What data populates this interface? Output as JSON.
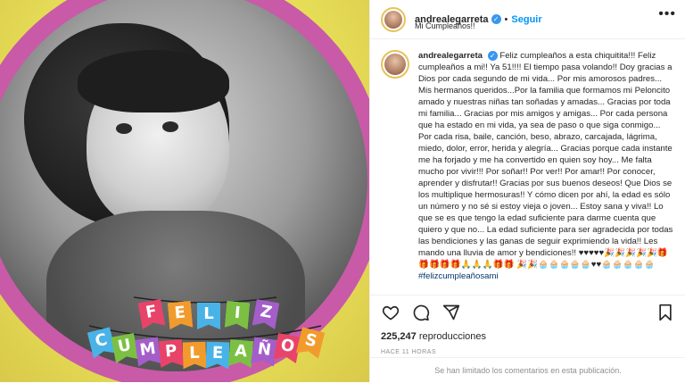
{
  "header": {
    "username": "andrealegarreta",
    "separator": "•",
    "follow_label": "Seguir",
    "subtitle": "Mi Cumpleaños!!",
    "more_icon": "more-horizontal-icon"
  },
  "media": {
    "banner_top": [
      "F",
      "E",
      "L",
      "I",
      "Z"
    ],
    "banner_bottom": [
      "C",
      "U",
      "M",
      "P",
      "L",
      "E",
      "A",
      "Ñ",
      "O",
      "S"
    ],
    "flag_colors": [
      "#e8446a",
      "#f29b2d",
      "#49b3e8",
      "#7bc043",
      "#a45ec9",
      "#e8446a",
      "#f29b2d",
      "#49b3e8",
      "#7bc043",
      "#a45ec9"
    ]
  },
  "caption": {
    "username": "andrealegarreta",
    "text": "Feliz cumpleaños a esta chiquitita!!! Feliz cumpleaños a mi!! Ya 51!!!! El tiempo pasa volando!! Doy gracias a Dios por cada segundo de mi vida... Por mis amorosos padres... Mis hermanos queridos...Por la familia que formamos mi Peloncito amado y nuestras niñas tan soñadas y amadas... Gracias por toda mi familia... Gracias por mis amigos y amigas... Por cada persona que ha estado en mi vida, ya sea de paso o que siga conmigo... Por cada risa, baile, canción, beso, abrazo, carcajada, lágrima, miedo, dolor, error, herida y alegría... Gracias porque cada instante me ha forjado y me ha convertido en quien soy hoy... Me falta mucho por vivir!!! Por soñar!! Por ver!! Por amar!! Por conocer, aprender y disfrutar!! Gracias por sus buenos deseos! Que Dios se los multiplique hermosuras!! Y cómo dicen por ahí, la edad es sólo un número y no sé si estoy vieja o joven... Estoy sana y viva!! Lo que se es que tengo la edad suficiente para darme cuenta que quiero y que no... La edad suficiente para ser agradecida por todas las bendiciones y las ganas de seguir exprimiendo la vida!! Les mando una lluvia de amor y bendiciones!! ♥♥♥♥♥🎉🎉🎉🎉🎉🎁🎁🎁🎁🎁🙏🙏🙏🎁🎁 🎉🎉🧁🧁🧁🧁🧁♥♥🧁🧁🧁🧁🧁",
    "hashtag": "#felizcumpleañosami"
  },
  "actions": {
    "like_icon": "heart-icon",
    "comment_icon": "comment-icon",
    "share_icon": "share-icon",
    "save_icon": "bookmark-icon"
  },
  "stats": {
    "views_count": "225,247",
    "views_label": "reproducciones",
    "time_ago": "HACE 11 HORAS"
  },
  "footer": {
    "comments_limited": "Se han limitado los comentarios en esta publicación."
  }
}
